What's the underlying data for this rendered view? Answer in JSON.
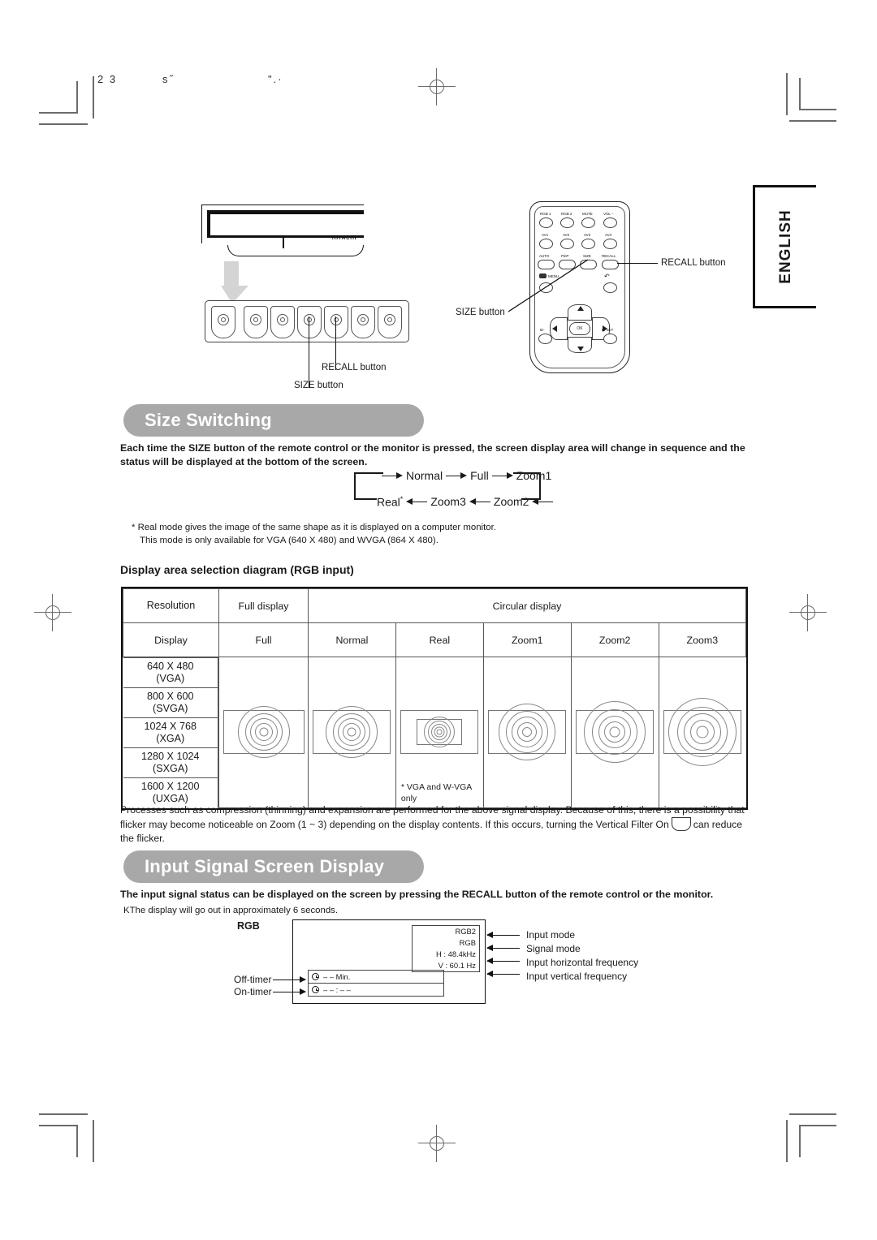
{
  "page": {
    "number_marks": [
      "2 3",
      "s˝",
      "\".·"
    ],
    "language_tab": "ENGLISH"
  },
  "illustration": {
    "monitor_logo": "HITACHI",
    "monitor_labels": {
      "recall": "RECALL button",
      "size": "SIZE button"
    },
    "remote_labels": {
      "recall": "RECALL button",
      "size": "SIZE button"
    },
    "remote_buttons": [
      "RGB 1",
      "RGB 2",
      "MUTE",
      "VOL −",
      "AV1",
      "AV2",
      "AV3",
      "AV4",
      "AUTO",
      "PinP",
      "SIZE",
      "RECALL",
      "MENU",
      "ID",
      "ID SET",
      "OK"
    ]
  },
  "size_switching": {
    "banner": "Size Switching",
    "intro": "Each time the SIZE button of the remote control or the monitor is pressed, the screen display area will change in sequence and the status will be displayed at the bottom of the screen.",
    "flow_top": [
      "Normal",
      "Full",
      "Zoom1"
    ],
    "flow_bottom": [
      "Real",
      "Zoom3",
      "Zoom2"
    ],
    "footnote_line1": "* Real mode gives the image of the same shape as it is displayed on a computer monitor.",
    "footnote_line2": "This mode is only available for VGA (640 X 480) and WVGA (864 X 480).",
    "diagram_title": "Display area selection diagram (RGB input)"
  },
  "table": {
    "header_row1": {
      "resolution": "Resolution",
      "full_display": "Full display",
      "circular_display": "Circular display"
    },
    "header_row2": [
      "Display",
      "Full",
      "Normal",
      "Real",
      "Zoom1",
      "Zoom2",
      "Zoom3"
    ],
    "resolutions": [
      {
        "res": "640 X 480",
        "name": "(VGA)"
      },
      {
        "res": "800 X 600",
        "name": "(SVGA)"
      },
      {
        "res": "1024 X 768",
        "name": "(XGA)"
      },
      {
        "res": "1280 X 1024",
        "name": "(SXGA)"
      },
      {
        "res": "1600 X 1200",
        "name": "(UXGA)"
      }
    ],
    "real_note_line1": "* VGA and W-VGA",
    "real_note_line2": "only"
  },
  "notes": {
    "processes_text_part1": "Processes such as compression (thinning) and expansion are performed for the above signal display. Because of this, there is a possibility that flicker may become noticeable on Zoom (1 ~ 3) depending on the display contents. If this occurs, turning the Vertical Filter On",
    "processes_text_part2": "can reduce the flicker."
  },
  "input_signal": {
    "banner": "Input Signal Screen Display",
    "intro": "The input signal status can be displayed on the screen by pressing the RECALL button of the remote control or the monitor.",
    "sub": "KThe display will go out in approximately 6 seconds.",
    "osd_title": "RGB",
    "osd_values": {
      "input_mode": "RGB2",
      "signal_mode": "RGB",
      "h_freq": "H :   48.4kHz",
      "v_freq": "V :   60.1  Hz",
      "off_timer": "– –  Min.",
      "on_timer": "– – : – –"
    },
    "callouts": [
      "Input mode",
      "Signal mode",
      "Input horizontal frequency",
      "Input vertical frequency"
    ],
    "timer_labels": {
      "off": "Off-timer",
      "on": "On-timer"
    }
  },
  "colors": {
    "banner_gray": "#a8a8a8",
    "text": "#1a1a1a",
    "rule": "#555555"
  }
}
